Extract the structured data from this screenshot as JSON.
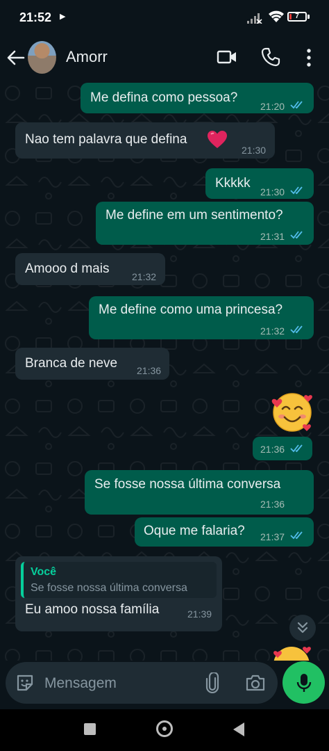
{
  "status_bar": {
    "time": "21:52",
    "battery": "7",
    "icons": [
      "play-icon",
      "signal-icon",
      "wifi-icon",
      "battery-icon"
    ]
  },
  "header": {
    "contact_name": "Amorr",
    "icons": [
      "back-arrow-icon",
      "video-call-icon",
      "phone-icon",
      "more-vert-icon"
    ]
  },
  "messages": [
    {
      "dir": "out",
      "text": "Me defina como pessoa?",
      "time": "21:20",
      "read": true
    },
    {
      "dir": "in",
      "text": "Nao tem palavra que defina",
      "emoji": "red-heart",
      "time": "21:30"
    },
    {
      "dir": "out",
      "text": "Kkkkk",
      "time": "21:30",
      "read": true
    },
    {
      "dir": "out",
      "text": "Me define em um sentimento?",
      "time": "21:31",
      "read": true
    },
    {
      "dir": "in",
      "text": "Amooo d mais",
      "time": "21:32"
    },
    {
      "dir": "out",
      "text": "Me define como uma princesa?",
      "time": "21:32",
      "read": true
    },
    {
      "dir": "in",
      "text": "Branca de neve",
      "time": "21:36"
    },
    {
      "dir": "out",
      "emoji": "smiling-face-with-hearts",
      "time": "21:36",
      "read": true
    },
    {
      "dir": "out",
      "text": "Se fosse nossa última conversa",
      "time": "21:36"
    },
    {
      "dir": "out",
      "text": "Oque me falaria?",
      "time": "21:37",
      "read": true
    },
    {
      "dir": "in",
      "quote_author": "Você",
      "quote_text": "Se fosse nossa última conversa",
      "text": "Eu amoo nossa família",
      "time": "21:39"
    }
  ],
  "input": {
    "placeholder": "Mensagem",
    "icons": [
      "sticker-icon",
      "attach-icon",
      "camera-icon",
      "mic-icon"
    ]
  },
  "colors": {
    "background": "#0b141a",
    "outgoing_bubble": "#005c4b",
    "incoming_bubble": "#1f2c34",
    "read_ticks": "#53bdeb",
    "accent_green": "#21c063",
    "quote_accent": "#06cf9c"
  }
}
